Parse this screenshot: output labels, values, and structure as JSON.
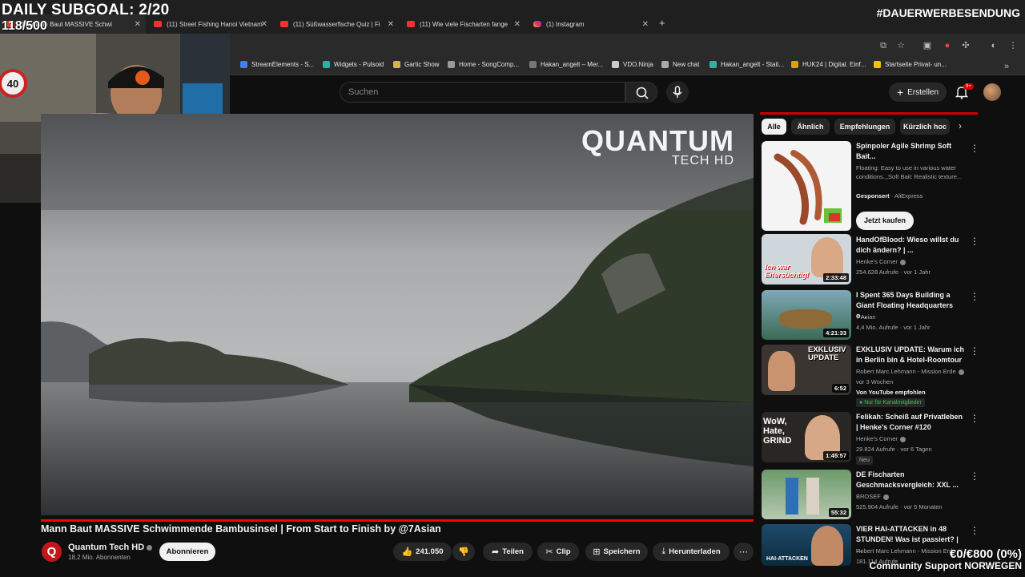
{
  "overlay": {
    "subgoal": "DAILY SUBGOAL: 2/20",
    "subcount": "118/500",
    "werbung": "#DAUERWERBESENDUNG",
    "donation": "€0/€800 (0%)",
    "community": "Community Support NORWEGEN"
  },
  "browser": {
    "tabs": [
      {
        "label": "(11) Mann Baut MASSIVE Schwi"
      },
      {
        "label": "(11) Street Fishing Hanoi Vietnam"
      },
      {
        "label": "(11) Süßwasserfische Quiz | Fi"
      },
      {
        "label": "(11) Wie viele Fischarten fange"
      },
      {
        "label": "(1) Instagram"
      }
    ],
    "bookmarks": [
      "StreamElements - S...",
      "Widgets - Pulsoid",
      "Gartic Show",
      "Home - SongComp...",
      "Hakan_angelt – Mer...",
      "VDO.Ninja",
      "New chat",
      "Hakan_angelt - Stati...",
      "HUK24 | Digital. Einf...",
      "Startseite Privat- un..."
    ]
  },
  "header": {
    "search_placeholder": "Suchen",
    "create_label": "Erstellen",
    "notif_badge": "9+"
  },
  "video": {
    "watermark_main": "QUANTUM",
    "watermark_sub": "TECH HD",
    "title": "Mann Baut MASSIVE Schwimmende Bambusinsel | From Start to Finish by @7Asian",
    "channel": "Quantum Tech HD",
    "channel_logo_letter": "Q",
    "subscribers": "18,2 Mio. Abonnenten",
    "subscribe_label": "Abonnieren",
    "likes": "241.050",
    "share_label": "Teilen",
    "clip_label": "Clip",
    "save_label": "Speichern",
    "download_label": "Herunterladen"
  },
  "sidebar": {
    "chips": [
      "Alle",
      "Ähnlich",
      "Empfehlungen",
      "Kürzlich hoc"
    ],
    "ad": {
      "title": "Spinpoler Agile Shrimp Soft Bait...",
      "description": "Floating: Easy to use in various water conditions.,,Soft Bait: Realistic texture...",
      "sponsored": "Gesponsert",
      "advertiser": "AliExpress",
      "cta": "Jetzt kaufen"
    },
    "items": [
      {
        "title": "HandOfBlood: Wieso willst du dich ändern? | ...",
        "channel": "Henke's Corner",
        "meta": "254.628 Aufrufe · vor 1 Jahr",
        "duration": "2:33:48",
        "thumb_text": "Ich war Eifersüchtig!"
      },
      {
        "title": "I Spent 365 Days Building a Giant Floating Headquarters o...",
        "channel": "7 Asian",
        "meta": "4,4 Mio. Aufrufe · vor 1 Jahr",
        "duration": "4:21:33"
      },
      {
        "title": "EXKLUSIV UPDATE: Warum ich in Berlin bin & Hotel-Roomtour",
        "channel": "Robert Marc Lehmann - Mission Erde",
        "meta": "vor 3 Wochen",
        "extra": "Von YouTube empfohlen",
        "pill": "Nur für Kanalmitglieder",
        "duration": "6:52",
        "thumb_text": "EXKLUSIV UPDATE"
      },
      {
        "title": "Felikah: Scheiß auf Privatleben | Henke's Corner #120",
        "channel": "Henke's Corner",
        "meta": "29.824 Aufrufe · vor 6 Tagen",
        "pill": "Neu",
        "duration": "1:45:57",
        "thumb_text": "WoW, Hate, GRIND"
      },
      {
        "title": "DE Fischarten Geschmacksvergleich: XXL ...",
        "channel": "BROSEF",
        "meta": "525.904 Aufrufe · vor 5 Monaten",
        "duration": "55:32"
      },
      {
        "title": "VIER HAI-ATTACKEN in 48 STUNDEN! Was ist passiert? | ...",
        "channel": "Robert Marc Lehmann - Mission Erde",
        "meta": "181.114 Aufrufe",
        "thumb_text": "HAI-ATTACKEN"
      }
    ]
  },
  "colors": {
    "yt_red": "#ff0000",
    "background": "#0f0f0f",
    "chip_bg": "#272727"
  }
}
